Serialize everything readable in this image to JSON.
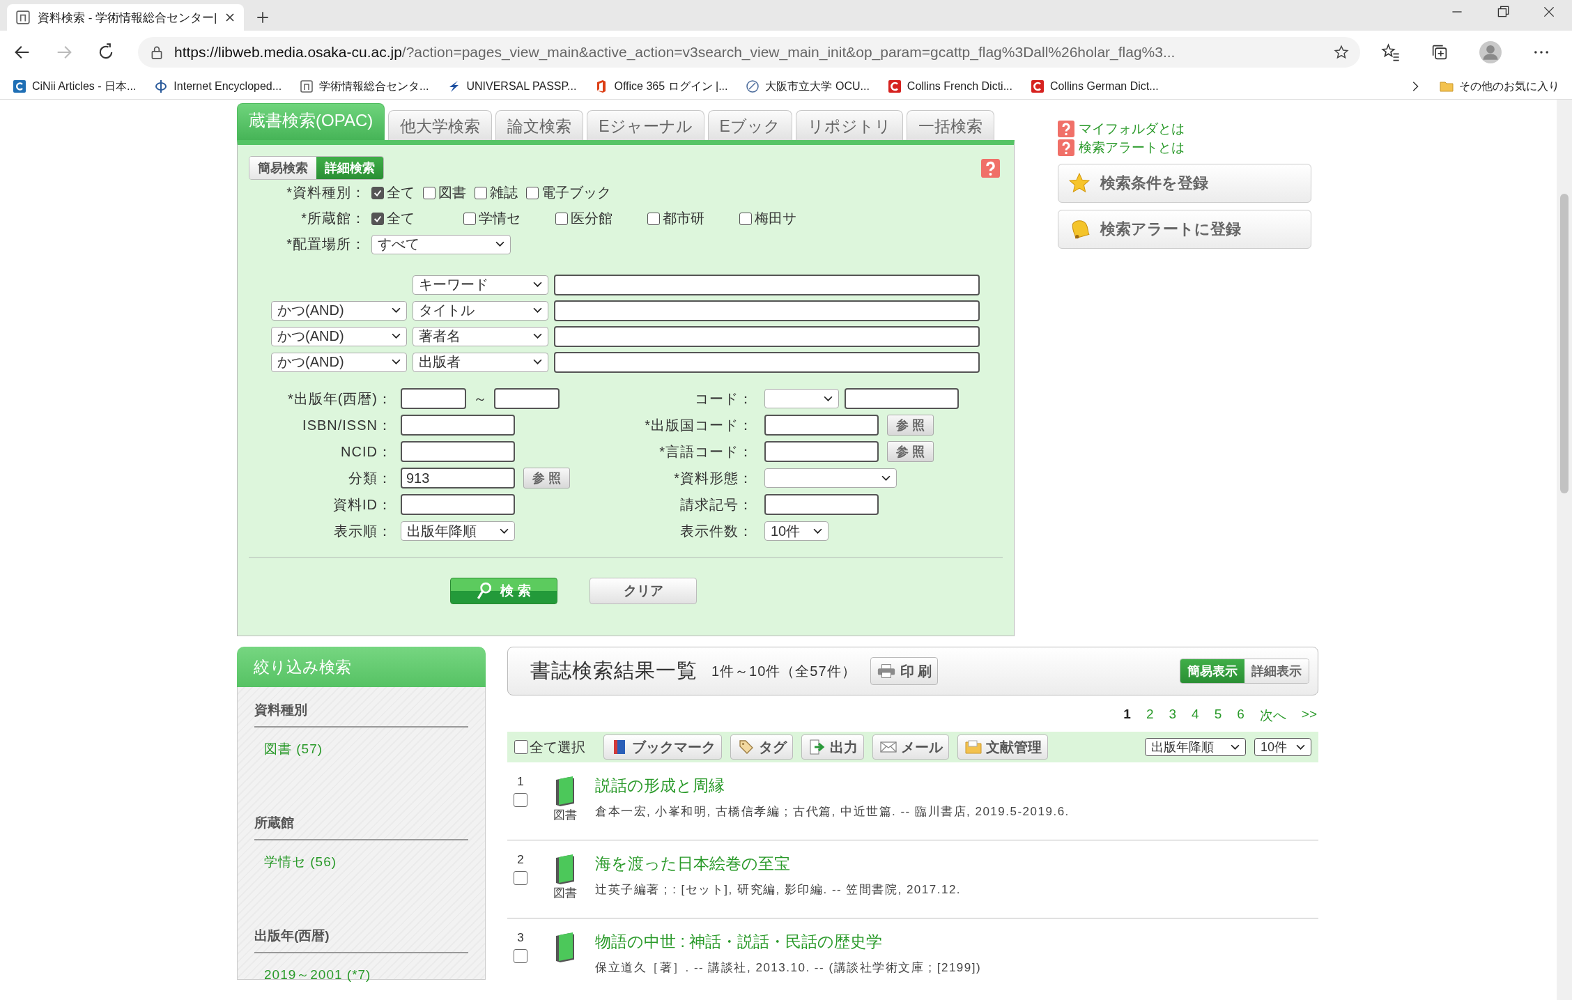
{
  "browser": {
    "tab_title": "資料検索 - 学術情報総合センター|",
    "url_host": "https://libweb.media.osaka-cu.ac.jp",
    "url_rest": "/?action=pages_view_main&active_action=v3search_view_main_init&op_param=gcattp_flag%3Dall%26holar_flag%3...",
    "forward_disabled": true,
    "bookmarks": [
      {
        "label": "CiNii Articles - 日本...",
        "kind": "ci"
      },
      {
        "label": "Internet Encycloped...",
        "kind": "phi"
      },
      {
        "label": "学術情報総合センタ...",
        "kind": "n"
      },
      {
        "label": "UNIVERSAL PASSP...",
        "kind": "bolt"
      },
      {
        "label": "Office 365 ログイン |...",
        "kind": "office"
      },
      {
        "label": "大阪市立大学 OCU...",
        "kind": "globe"
      },
      {
        "label": "Collins French Dicti...",
        "kind": "c"
      },
      {
        "label": "Collins German Dict...",
        "kind": "c"
      }
    ],
    "other_favorites": "その他のお気に入り"
  },
  "search_tabs": [
    {
      "label": "蔵書検索(OPAC)",
      "selected": true
    },
    {
      "label": "他大学検索",
      "selected": false
    },
    {
      "label": "論文検索",
      "selected": false
    },
    {
      "label": "Eジャーナル",
      "selected": false
    },
    {
      "label": "Eブック",
      "selected": false
    },
    {
      "label": "リポジトリ",
      "selected": false
    },
    {
      "label": "一括検索",
      "selected": false
    }
  ],
  "mode_toggle": [
    {
      "label": "簡易検索",
      "selected": false
    },
    {
      "label": "詳細検索",
      "selected": true
    }
  ],
  "check_groups": [
    {
      "label": "*資料種別：",
      "options": [
        {
          "label": "全て",
          "checked": true
        },
        {
          "label": "図書",
          "checked": false
        },
        {
          "label": "雑誌",
          "checked": false
        },
        {
          "label": "電子ブック",
          "checked": false
        }
      ]
    },
    {
      "label": "*所蔵館：",
      "options": [
        {
          "label": "全て",
          "checked": true
        },
        {
          "label": "学情セ",
          "checked": false
        },
        {
          "label": "医分館",
          "checked": false
        },
        {
          "label": "都市研",
          "checked": false
        },
        {
          "label": "梅田サ",
          "checked": false
        }
      ]
    }
  ],
  "location": {
    "label": "*配置場所：",
    "value": "すべて"
  },
  "keyword_rows": [
    {
      "field": "キーワード"
    },
    {
      "operator": "かつ(AND)",
      "field": "タイトル"
    },
    {
      "operator": "かつ(AND)",
      "field": "著者名"
    },
    {
      "operator": "かつ(AND)",
      "field": "出版者"
    }
  ],
  "fields_left": [
    {
      "label": "*出版年(西暦)：",
      "kind": "range",
      "separator": "～"
    },
    {
      "label": "ISBN/ISSN：",
      "kind": "input"
    },
    {
      "label": "NCID：",
      "kind": "input"
    },
    {
      "label": "分類：",
      "kind": "input",
      "value": "913",
      "ref_button": "参 照"
    },
    {
      "label": "資料ID：",
      "kind": "input"
    },
    {
      "label": "表示順：",
      "kind": "select",
      "value": "出版年降順"
    }
  ],
  "fields_right": [
    {
      "label": "コード：",
      "kind": "select_input"
    },
    {
      "label": "*出版国コード：",
      "kind": "input",
      "ref_button": "参 照"
    },
    {
      "label": "*言語コード：",
      "kind": "input",
      "ref_button": "参 照"
    },
    {
      "label": "*資料形態：",
      "kind": "select"
    },
    {
      "label": "請求記号：",
      "kind": "input"
    },
    {
      "label": "表示件数：",
      "kind": "select_small",
      "value": "10件"
    }
  ],
  "search_button": "検 索",
  "clear_button": "クリア",
  "help_links": [
    "マイフォルダとは",
    "検索アラートとは"
  ],
  "side_buttons": [
    {
      "label": "検索条件を登録",
      "kind": "star"
    },
    {
      "label": "検索アラートに登録",
      "kind": "bell"
    }
  ],
  "refine": {
    "title": "絞り込み検索",
    "groups": [
      {
        "heading": "資料種別",
        "items": [
          "図書 (57)"
        ]
      },
      {
        "heading": "所蔵館",
        "items": [
          "学情セ (56)"
        ]
      },
      {
        "heading": "出版年(西暦)",
        "items": [
          "2019～2001 (*7)"
        ]
      }
    ]
  },
  "results_header": {
    "title": "書誌検索結果一覧",
    "count": "1件～10件（全57件）",
    "print": "印 刷",
    "views": [
      {
        "label": "簡易表示",
        "selected": true
      },
      {
        "label": "詳細表示",
        "selected": false
      }
    ]
  },
  "pagination": [
    {
      "label": "1",
      "selected": true
    },
    {
      "label": "2",
      "selected": false
    },
    {
      "label": "3",
      "selected": false
    },
    {
      "label": "4",
      "selected": false
    },
    {
      "label": "5",
      "selected": false
    },
    {
      "label": "6",
      "selected": false
    },
    {
      "label": "次へ",
      "selected": false
    },
    {
      "label": ">>",
      "selected": false
    }
  ],
  "toolbar": {
    "select_all": {
      "label": "全て選択",
      "checked": false
    },
    "buttons": [
      {
        "label": "ブックマーク",
        "kind": "bookmark"
      },
      {
        "label": "タグ",
        "kind": "tag"
      },
      {
        "label": "出力",
        "kind": "export"
      },
      {
        "label": "メール",
        "kind": "mail"
      },
      {
        "label": "文献管理",
        "kind": "folder"
      }
    ],
    "sort": "出版年降順",
    "per_page": "10件"
  },
  "results": [
    {
      "number": "1",
      "checked": false,
      "type": "図書",
      "title": "説話の形成と周縁",
      "details": "倉本一宏, 小峯和明, 古橋信孝編 ; 古代篇, 中近世篇. -- 臨川書店, 2019.5-2019.6."
    },
    {
      "number": "2",
      "checked": false,
      "type": "図書",
      "title": "海を渡った日本絵巻の至宝",
      "details": "辻英子編著 ; : [セット], 研究編, 影印編. -- 笠間書院, 2017.12."
    },
    {
      "number": "3",
      "checked": false,
      "title": "物語の中世 : 神話・説話・民話の歴史学",
      "details": "保立道久［著］. -- 講談社, 2013.10. -- (講談社学術文庫 ; [2199])"
    }
  ]
}
